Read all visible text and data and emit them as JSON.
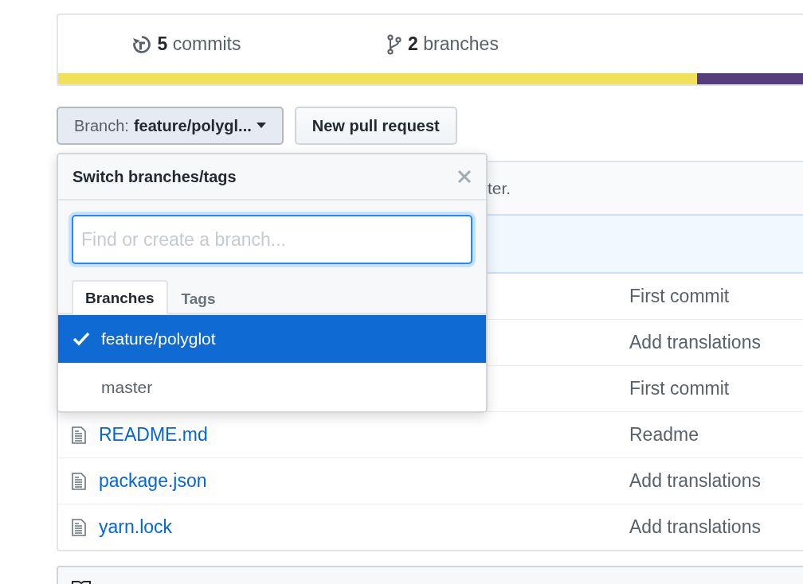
{
  "stats": [
    {
      "kind": "commits",
      "count": "5",
      "label": "commits"
    },
    {
      "kind": "branches",
      "count": "2",
      "label": "branches"
    }
  ],
  "languages": [
    {
      "color": "#f1e05a",
      "level": 0.83
    },
    {
      "color": "#563d7c",
      "level": 0.17
    }
  ],
  "branch_button": {
    "prefix": "Branch:",
    "value": "feature/polygl..."
  },
  "new_pull_request": "New pull request",
  "commit_tease": {
    "text": "ter."
  },
  "files": [
    {
      "message": "First commit"
    },
    {
      "message": "Add translations"
    },
    {
      "message": "First commit"
    },
    {
      "name": "README.md",
      "message": "Readme"
    },
    {
      "name": "package.json",
      "message": "Add translations"
    },
    {
      "name": "yarn.lock",
      "message": "Add translations"
    }
  ],
  "branch_menu": {
    "title": "Switch branches/tags",
    "placeholder": "Find or create a branch...",
    "tabs": [
      {
        "label": "Branches",
        "selected": true
      },
      {
        "label": "Tags",
        "selected": false
      }
    ],
    "items": [
      {
        "name": "feature/polyglot",
        "selected": true
      },
      {
        "name": "master",
        "selected": false
      }
    ]
  }
}
